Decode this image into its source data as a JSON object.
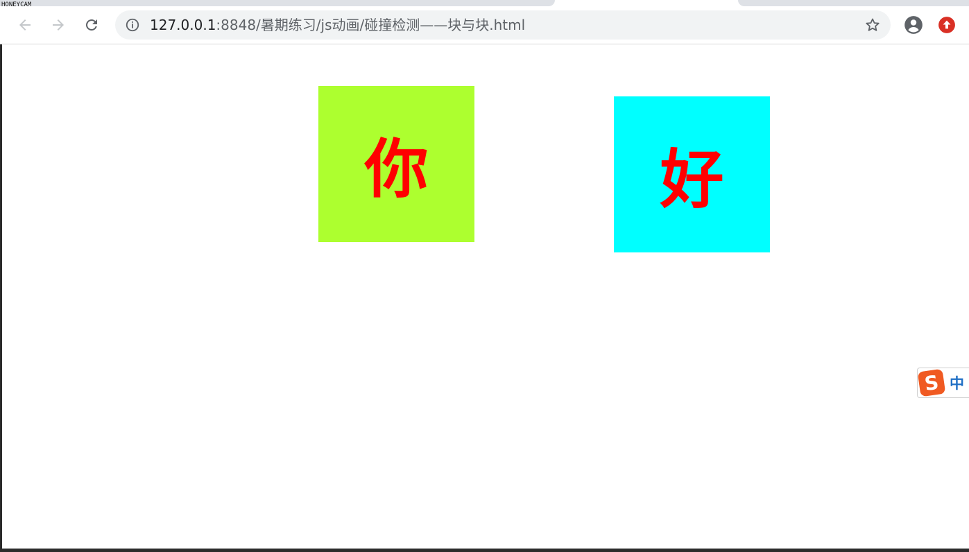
{
  "watermark": "HONEYCAM",
  "browser": {
    "url_host": "127.0.0.1",
    "url_path": ":8848/暑期练习/js动画/碰撞检测——块与块.html",
    "icons": [
      "back-arrow-icon",
      "forward-arrow-icon",
      "reload-icon",
      "info-icon",
      "star-icon",
      "account-icon",
      "update-icon"
    ]
  },
  "blocks": [
    {
      "text": "你",
      "color": "#adff2f"
    },
    {
      "text": "好",
      "color": "#00ffff"
    }
  ],
  "ime": {
    "logo": "S",
    "label": "中"
  },
  "colors": {
    "block_text": "#ff0000",
    "update_badge": "#d93025",
    "ime_logo": "#f05a22"
  }
}
